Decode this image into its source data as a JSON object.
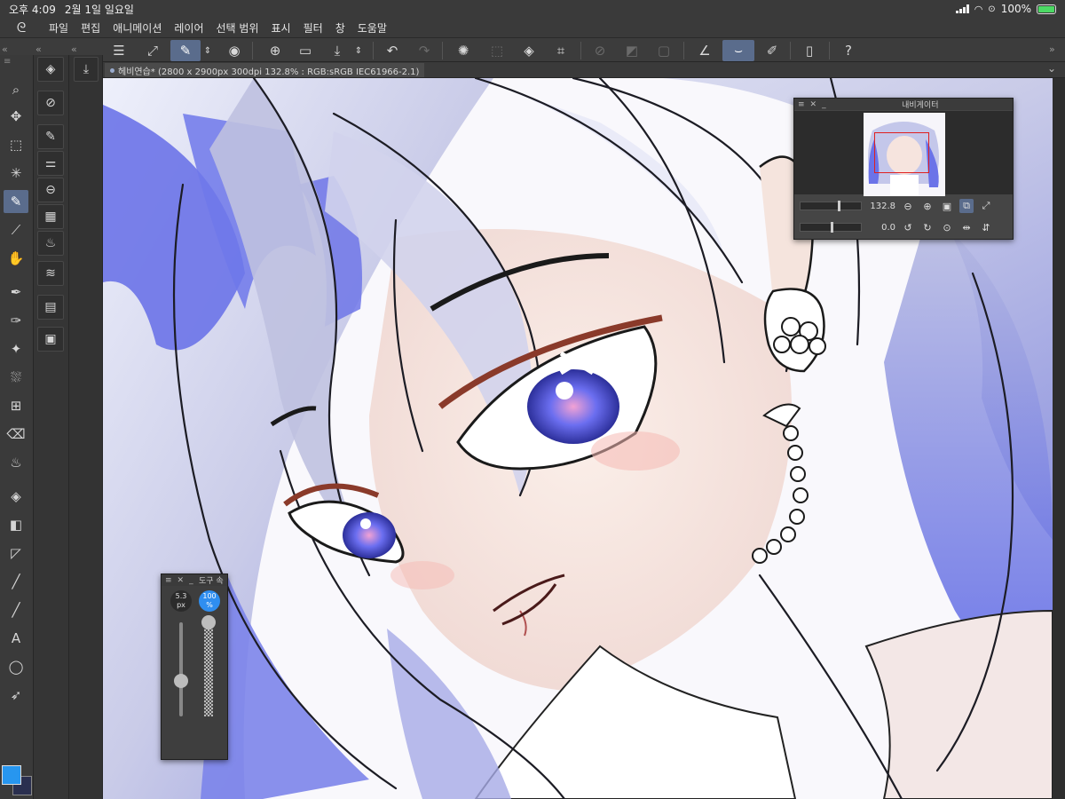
{
  "status_bar": {
    "time": "오후 4:09",
    "date": "2월 1일 일요일",
    "battery": "100%",
    "battery_level": 1.0
  },
  "menu": {
    "items": [
      "파일",
      "편집",
      "애니메이션",
      "레이어",
      "선택 범위",
      "표시",
      "필터",
      "창",
      "도움말"
    ]
  },
  "document": {
    "tab_title": "헤비연습* (2800 x 2900px 300dpi 132.8% : RGB:sRGB IEC61966-2.1)"
  },
  "navigator": {
    "title": "내비게이터",
    "zoom_value": "132.8",
    "rotation_value": "0.0"
  },
  "tool_property": {
    "title": "도구 속",
    "brush_size": "5.3",
    "brush_size_unit": "px",
    "opacity": "100",
    "opacity_unit": "%"
  },
  "colors": {
    "accent": "#5a6c8c",
    "foreground": "#2796ef",
    "background": "#2a2f4f",
    "hair_blue": "#5f6ee8",
    "hair_light": "#d7d8ef",
    "skin": "#f6e6e0"
  },
  "icons": {
    "left_tools": [
      "zoom-icon",
      "move-icon",
      "select-rect-icon",
      "wand-icon",
      "pen-icon",
      "eyedropper-icon",
      "hand-icon",
      "pen-tool-icon",
      "brush-icon",
      "decoration-icon",
      "airbrush-icon",
      "mesh-icon",
      "eraser-icon",
      "blend-icon",
      "fill-icon",
      "gradient-icon",
      "figure-icon",
      "line-icon",
      "ruler-icon",
      "text-icon",
      "lasso-icon",
      "operation-icon"
    ]
  }
}
